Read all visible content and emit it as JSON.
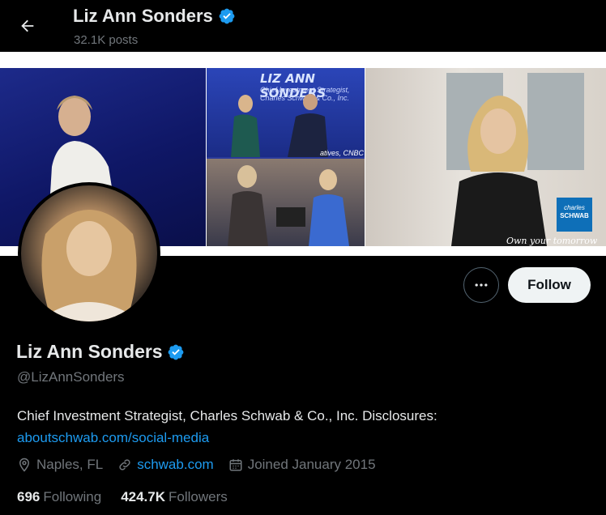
{
  "header": {
    "name": "Liz Ann Sonders",
    "posts": "32.1K posts"
  },
  "banner": {
    "title": "LIZ ANN SONDERS",
    "subtitle": "Chief Investment Strategist, Charles Schwab & Co., Inc.",
    "cnbc_fragment": "atives, CNBC",
    "logo_line1": "charles",
    "logo_line2": "SCHWAB",
    "tagline": "Own your tomorrow"
  },
  "actions": {
    "follow_label": "Follow"
  },
  "profile": {
    "name": "Liz Ann Sonders",
    "handle": "@LizAnnSonders",
    "bio_text": "Chief Investment Strategist, Charles Schwab & Co., Inc. Disclosures:",
    "bio_link": "aboutschwab.com/social-media",
    "location": "Naples, FL",
    "website": "schwab.com",
    "joined": "Joined January 2015",
    "following_count": "696",
    "following_label": "Following",
    "followers_count": "424.7K",
    "followers_label": "Followers"
  },
  "colors": {
    "accent": "#1d9bf0",
    "verified": "#1d9bf0",
    "secondary_text": "#71767b"
  }
}
